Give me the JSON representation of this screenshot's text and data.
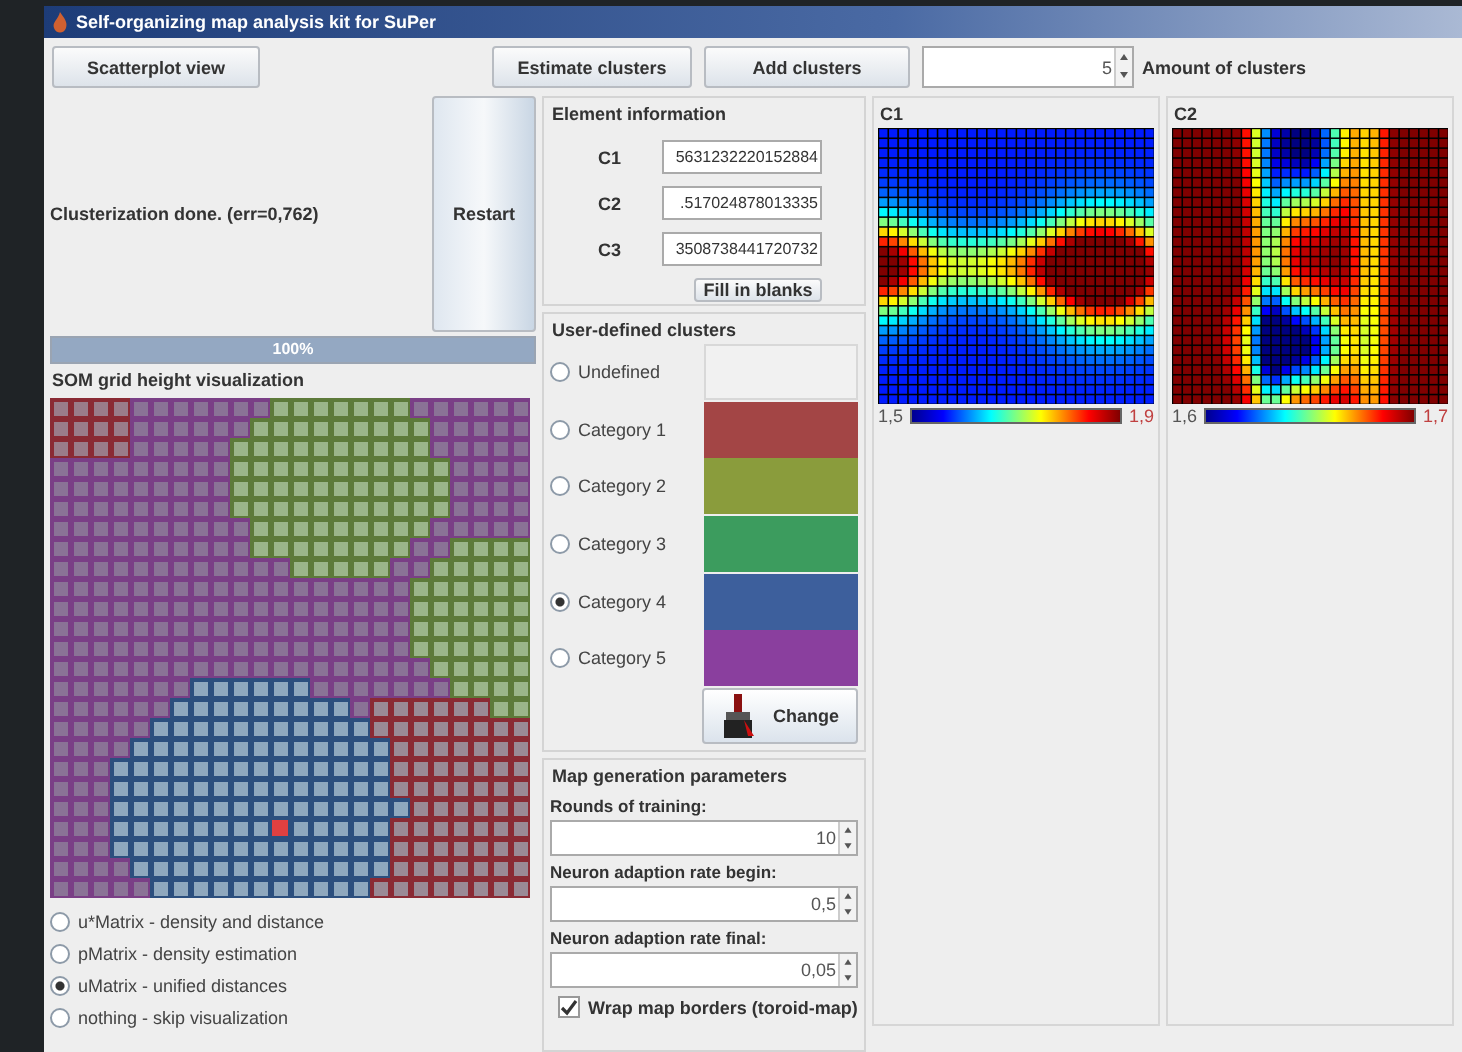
{
  "window": {
    "title": "Self-organizing map analysis kit for SuPer"
  },
  "toolbar": {
    "buttons": [
      "Scatterplot view",
      "Estimate clusters",
      "Add clusters"
    ],
    "clusters_spinner": {
      "value": "5"
    },
    "clusters_label": "Amount of clusters"
  },
  "status": {
    "text": "Clusterization done. (err=0,762)",
    "restart_button": "Restart",
    "progress": {
      "level": 1,
      "label": "100%"
    }
  },
  "som_panel": {
    "title": "SOM grid height visualization",
    "modes": [
      {
        "label": "u*Matrix - density and distance",
        "selected": false
      },
      {
        "label": "pMatrix - density estimation",
        "selected": false
      },
      {
        "label": "uMatrix - unified distances",
        "selected": true
      },
      {
        "label": "nothing - skip visualization",
        "selected": false
      }
    ]
  },
  "element_information": {
    "title": "Element information",
    "fields": [
      {
        "label": "C1",
        "value": "5631232220152884"
      },
      {
        "label": "C2",
        "value": ".517024878013335"
      },
      {
        "label": "C3",
        "value": "3508738441720732"
      }
    ],
    "button": "Fill in blanks"
  },
  "user_defined_clusters": {
    "title": "User-defined clusters",
    "categories": [
      {
        "label": "Undefined",
        "selected": false
      },
      {
        "label": "Category 1",
        "selected": false,
        "color": "#a34545"
      },
      {
        "label": "Category 2",
        "selected": false,
        "color": "#8a9c3c"
      },
      {
        "label": "Category 3",
        "selected": false,
        "color": "#3c9c5e"
      },
      {
        "label": "Category 4",
        "selected": true,
        "color": "#3d5f9c"
      },
      {
        "label": "Category 5",
        "selected": false,
        "color": "#8a3f9e"
      }
    ],
    "change_button": "Change"
  },
  "map_generation": {
    "title": "Map generation parameters",
    "fields": [
      {
        "label": "Rounds of training:",
        "value": "10"
      },
      {
        "label": "Neuron adaption rate begin:",
        "value": "0,5"
      },
      {
        "label": "Neuron adaption rate final:",
        "value": "0,05"
      }
    ],
    "wrap": {
      "label": "Wrap map borders (toroid-map)",
      "checked": true
    }
  },
  "component_maps": [
    {
      "title": "C1",
      "min": "1,5",
      "max": "1,9"
    },
    {
      "title": "C2",
      "min": "1,6",
      "max": "1,7"
    }
  ]
}
